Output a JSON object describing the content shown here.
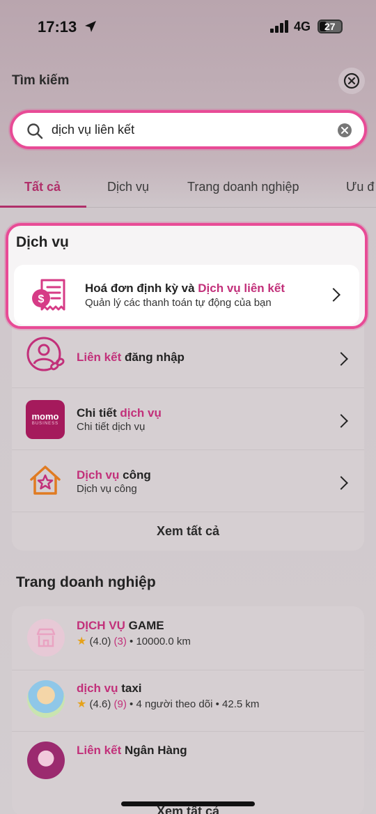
{
  "status_bar": {
    "time": "17:13",
    "network": "4G",
    "battery": "27"
  },
  "header": {
    "title": "Tìm kiếm"
  },
  "search": {
    "value": "dịch vụ liên kết"
  },
  "tabs": [
    "Tất cả",
    "Dịch vụ",
    "Trang doanh nghiệp",
    "Ưu đ"
  ],
  "services": {
    "title": "Dịch vụ",
    "items": [
      {
        "title_plain": "Hoá đơn định kỳ và ",
        "title_hl": "Dịch vụ liên kết",
        "subtitle": "Quản lý các thanh toán tự động của bạn"
      },
      {
        "title_hl": "Liên kết",
        "title_plain": " đăng nhập"
      },
      {
        "title_plain": "Chi tiết ",
        "title_hl": "dịch vụ",
        "subtitle": "Chi tiết dịch vụ",
        "logo_text": "momo",
        "logo_sub": "BUSINESS"
      },
      {
        "title_hl": "Dịch vụ",
        "title_plain": " công",
        "subtitle": "Dịch vụ công"
      }
    ],
    "see_all": "Xem tất cả"
  },
  "business": {
    "title": "Trang doanh nghiệp",
    "items": [
      {
        "title_hl": "DỊCH VỤ",
        "title_plain": " GAME",
        "rating": "(4.0)",
        "count": "(3)",
        "meta": "• 10000.0 km"
      },
      {
        "title_hl": "dịch vụ",
        "title_plain": " taxi",
        "rating": "(4.6)",
        "count": "(9)",
        "meta": "• 4 người theo dõi • 42.5 km"
      },
      {
        "title_hl": "Liên kết",
        "title_plain": " Ngân Hàng"
      }
    ],
    "see_all": "Xem tất cả"
  },
  "colors": {
    "accent": "#e84b96",
    "highlight_text": "#c2307a",
    "star": "#e6a21a"
  }
}
